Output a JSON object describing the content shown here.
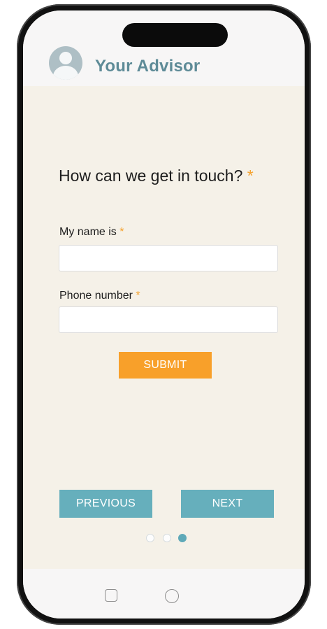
{
  "app": {
    "brand_name": "Your Advisor",
    "avatar_icon": "user-avatar-icon"
  },
  "form": {
    "question": "How can we get in touch?",
    "question_required_marker": "*",
    "name_label": "My name is",
    "name_required_marker": "*",
    "name_value": "",
    "phone_label": "Phone number",
    "phone_required_marker": "*",
    "phone_value": "",
    "submit_label": "SUBMIT"
  },
  "navigation": {
    "previous_label": "PREVIOUS",
    "next_label": "NEXT",
    "page_count": 3,
    "current_page": 3
  },
  "device_nav": {
    "icons": [
      "recent-apps-square-icon",
      "home-circle-icon"
    ]
  },
  "colors": {
    "brand_text": "#5e8b97",
    "required": "#f5a12b",
    "submit_button": "#f8a02a",
    "nav_button": "#66afbc",
    "content_background": "#f5f1e8",
    "active_dot": "#5ea9b8"
  }
}
